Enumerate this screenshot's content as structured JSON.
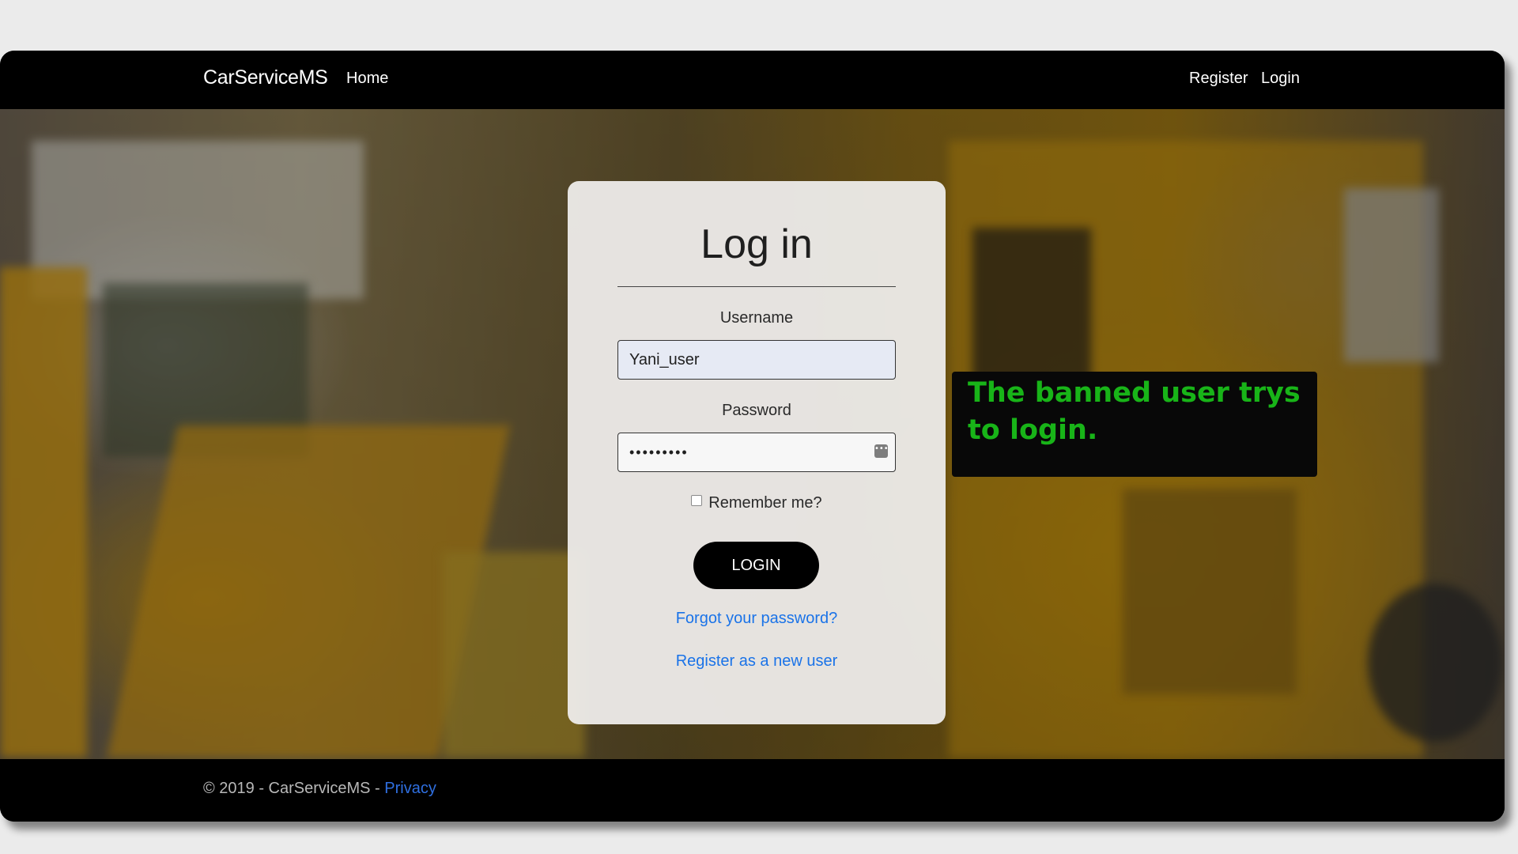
{
  "navbar": {
    "brand": "CarServiceMS",
    "home": "Home",
    "register": "Register",
    "login": "Login"
  },
  "login_form": {
    "title": "Log in",
    "username_label": "Username",
    "username_value": "Yani_user",
    "password_label": "Password",
    "password_value": "•••••••••",
    "remember_label": "Remember me?",
    "remember_checked": false,
    "submit_label": "LOGIN",
    "forgot_link": "Forgot your password?",
    "register_link": "Register as a new user"
  },
  "caption": {
    "text": "The banned user trys to login."
  },
  "footer": {
    "copyright": "© 2019 - CarServiceMS - ",
    "privacy": "Privacy"
  },
  "colors": {
    "link": "#1a73e8",
    "caption_text": "#18b418",
    "button_bg": "#000000"
  },
  "icons": {
    "password_manager": "password-manager-icon",
    "remember": "checkbox-icon"
  }
}
